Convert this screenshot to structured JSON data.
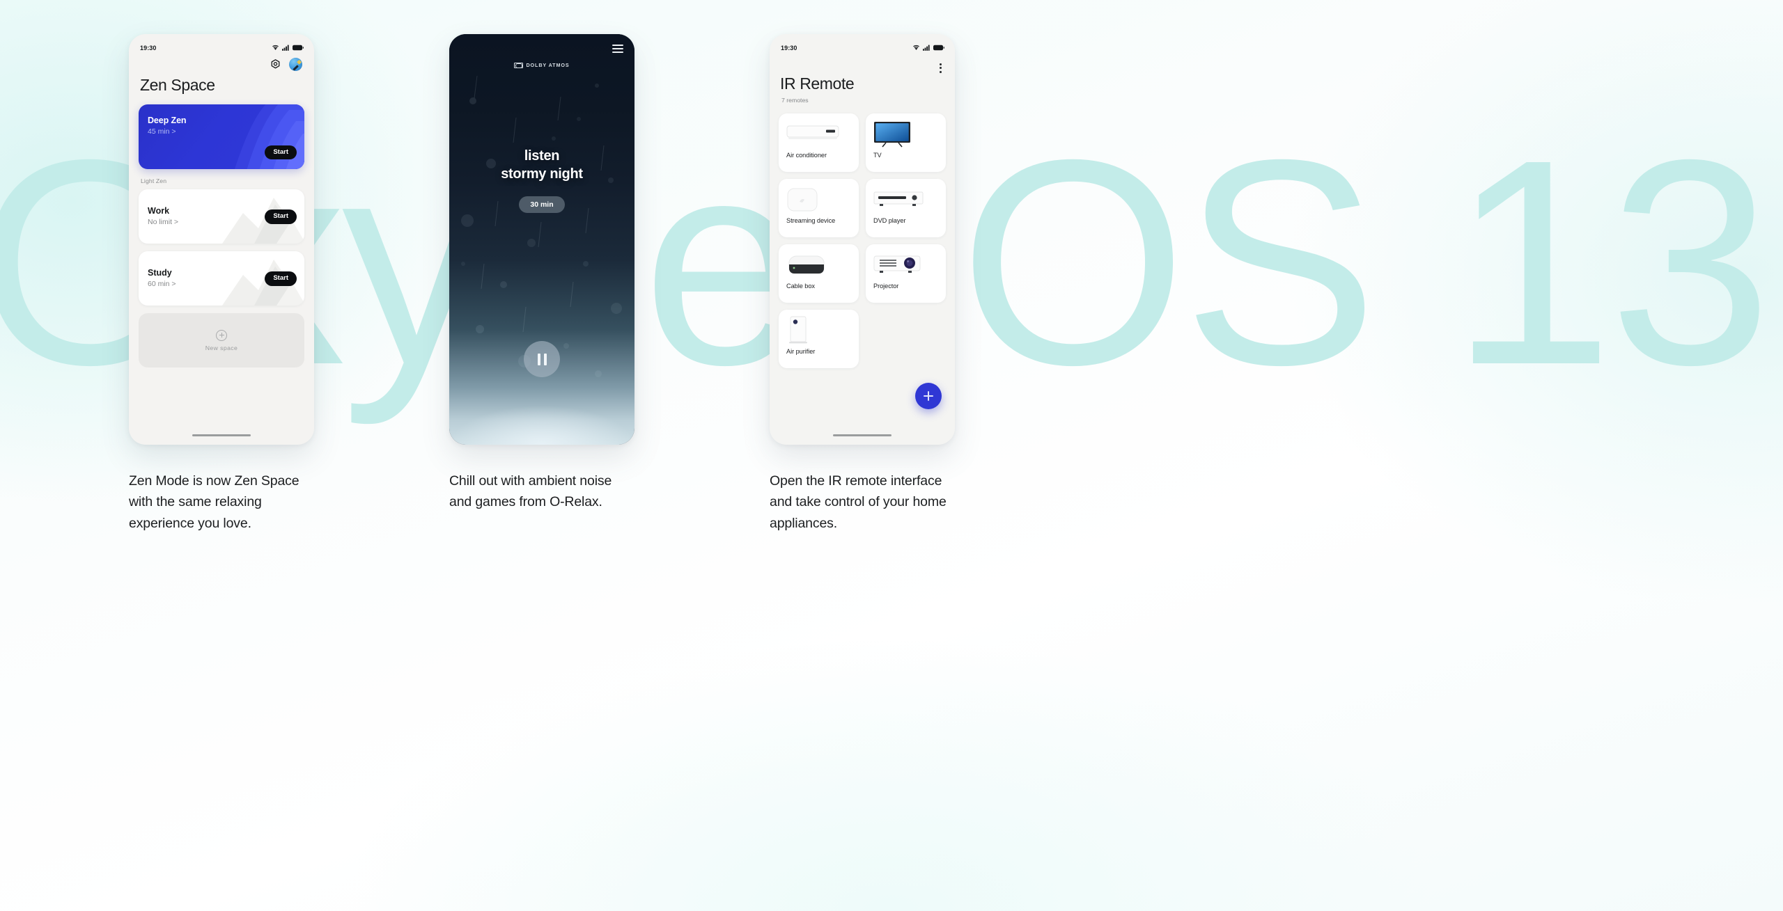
{
  "background": {
    "watermark_text": "OxygenOS 13",
    "watermark_color": "#c3ece9"
  },
  "phones": [
    {
      "id": "zen-space",
      "status_bar": {
        "time": "19:30",
        "icons": [
          "wifi-icon",
          "signal-icon",
          "battery-icon"
        ]
      },
      "header": {
        "settings_icon": "gear-icon",
        "avatar_label": "profile-avatar",
        "title": "Zen Space"
      },
      "featured_card": {
        "title": "Deep Zen",
        "duration": "45 min >",
        "start_label": "Start",
        "accent_color": "#2d36d6"
      },
      "section_label": "Light Zen",
      "cards": [
        {
          "title": "Work",
          "duration": "No limit >",
          "start_label": "Start"
        },
        {
          "title": "Study",
          "duration": "60 min >",
          "start_label": "Start"
        }
      ],
      "new_space": {
        "icon": "plus-circle-icon",
        "label": "New  space"
      }
    },
    {
      "id": "o-relax",
      "status_bar": {
        "time": "19:30",
        "icons": [
          "wifi-icon",
          "signal-icon",
          "battery-icon"
        ]
      },
      "brand": "DOLBY ATMOS",
      "menu_icon": "hamburger-icon",
      "headline_line1": "listen",
      "headline_line2": "stormy night",
      "timer_chip": "30 min",
      "transport": {
        "state_icon": "pause-icon"
      }
    },
    {
      "id": "ir-remote",
      "status_bar": {
        "time": "19:30",
        "icons": [
          "wifi-icon",
          "signal-icon",
          "battery-icon"
        ]
      },
      "overflow_icon": "kebab-menu-icon",
      "title": "IR Remote",
      "subtitle": "7 remotes",
      "remotes": [
        {
          "label": "Air conditioner",
          "icon": "air-conditioner-icon"
        },
        {
          "label": "TV",
          "icon": "tv-icon"
        },
        {
          "label": "Streaming device",
          "icon": "streaming-device-icon"
        },
        {
          "label": "DVD player",
          "icon": "dvd-player-icon"
        },
        {
          "label": "Cable box",
          "icon": "cable-box-icon"
        },
        {
          "label": "Projector",
          "icon": "projector-icon"
        },
        {
          "label": "Air purifier",
          "icon": "air-purifier-icon"
        }
      ],
      "fab": {
        "icon": "plus-icon",
        "color": "#2f37d4"
      }
    }
  ],
  "captions": [
    "Zen Mode is now Zen Space with the same relaxing experience you love.",
    "Chill out with ambient noise and games from O-Relax.",
    "Open the IR remote interface and take control of your home appliances."
  ]
}
